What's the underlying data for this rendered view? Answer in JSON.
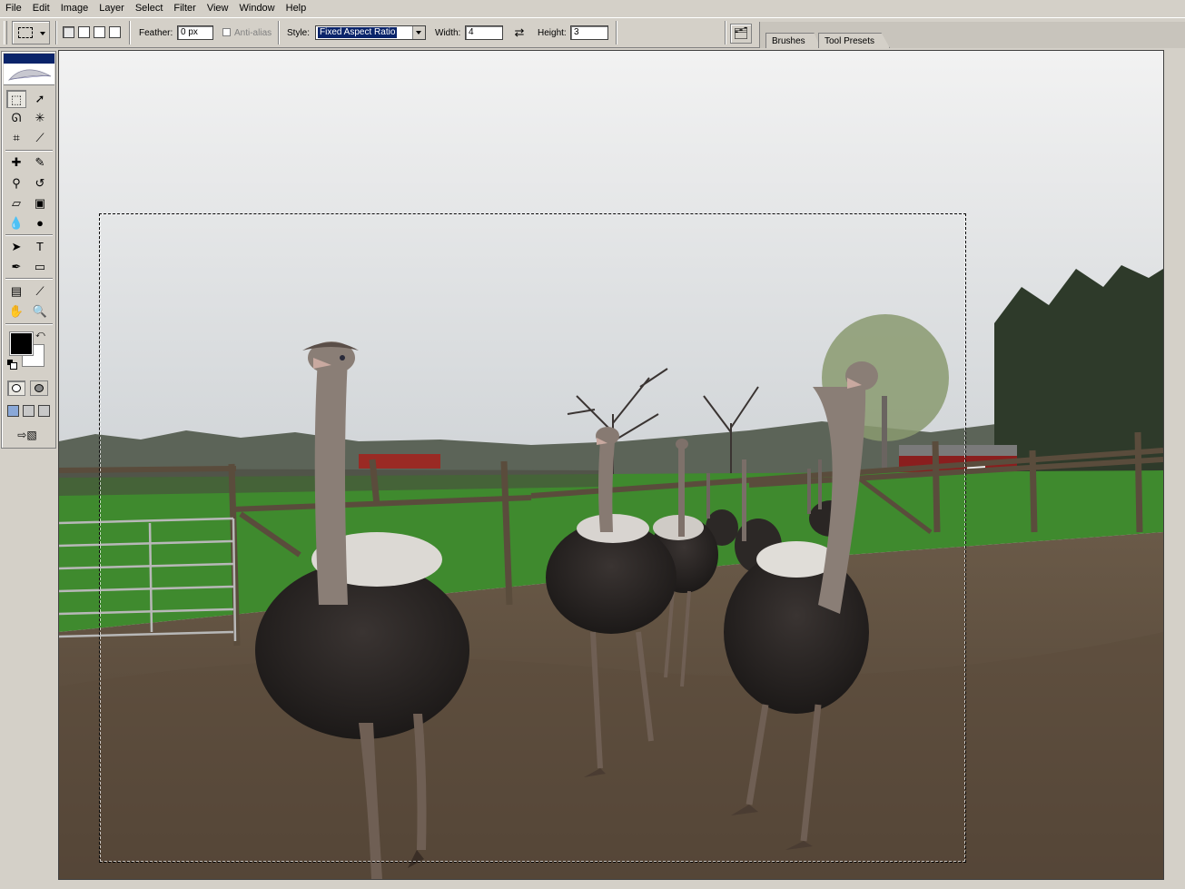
{
  "menu": {
    "items": [
      "File",
      "Edit",
      "Image",
      "Layer",
      "Select",
      "Filter",
      "View",
      "Window",
      "Help"
    ]
  },
  "options": {
    "feather_label": "Feather:",
    "feather_value": "0 px",
    "antialias_label": "Anti-alias",
    "style_label": "Style:",
    "style_value": "Fixed Aspect Ratio",
    "width_label": "Width:",
    "width_value": "4",
    "height_label": "Height:",
    "height_value": "3"
  },
  "palette_well": {
    "tabs": [
      "Brushes",
      "Tool Presets"
    ]
  },
  "toolbox": {
    "fg_color": "#000000",
    "bg_color": "#ffffff",
    "tools": [
      "rectangular-marquee-icon",
      "move-icon",
      "lasso-icon",
      "magic-wand-icon",
      "crop-icon",
      "slice-icon",
      "healing-brush-icon",
      "brush-icon",
      "clone-stamp-icon",
      "history-brush-icon",
      "eraser-icon",
      "gradient-icon",
      "blur-icon",
      "dodge-icon",
      "path-selection-icon",
      "type-icon",
      "pen-icon",
      "rectangle-shape-icon",
      "notes-icon",
      "eyedropper-icon",
      "hand-icon",
      "zoom-icon"
    ]
  },
  "document": {
    "image_subject": "ostriches-photo"
  }
}
